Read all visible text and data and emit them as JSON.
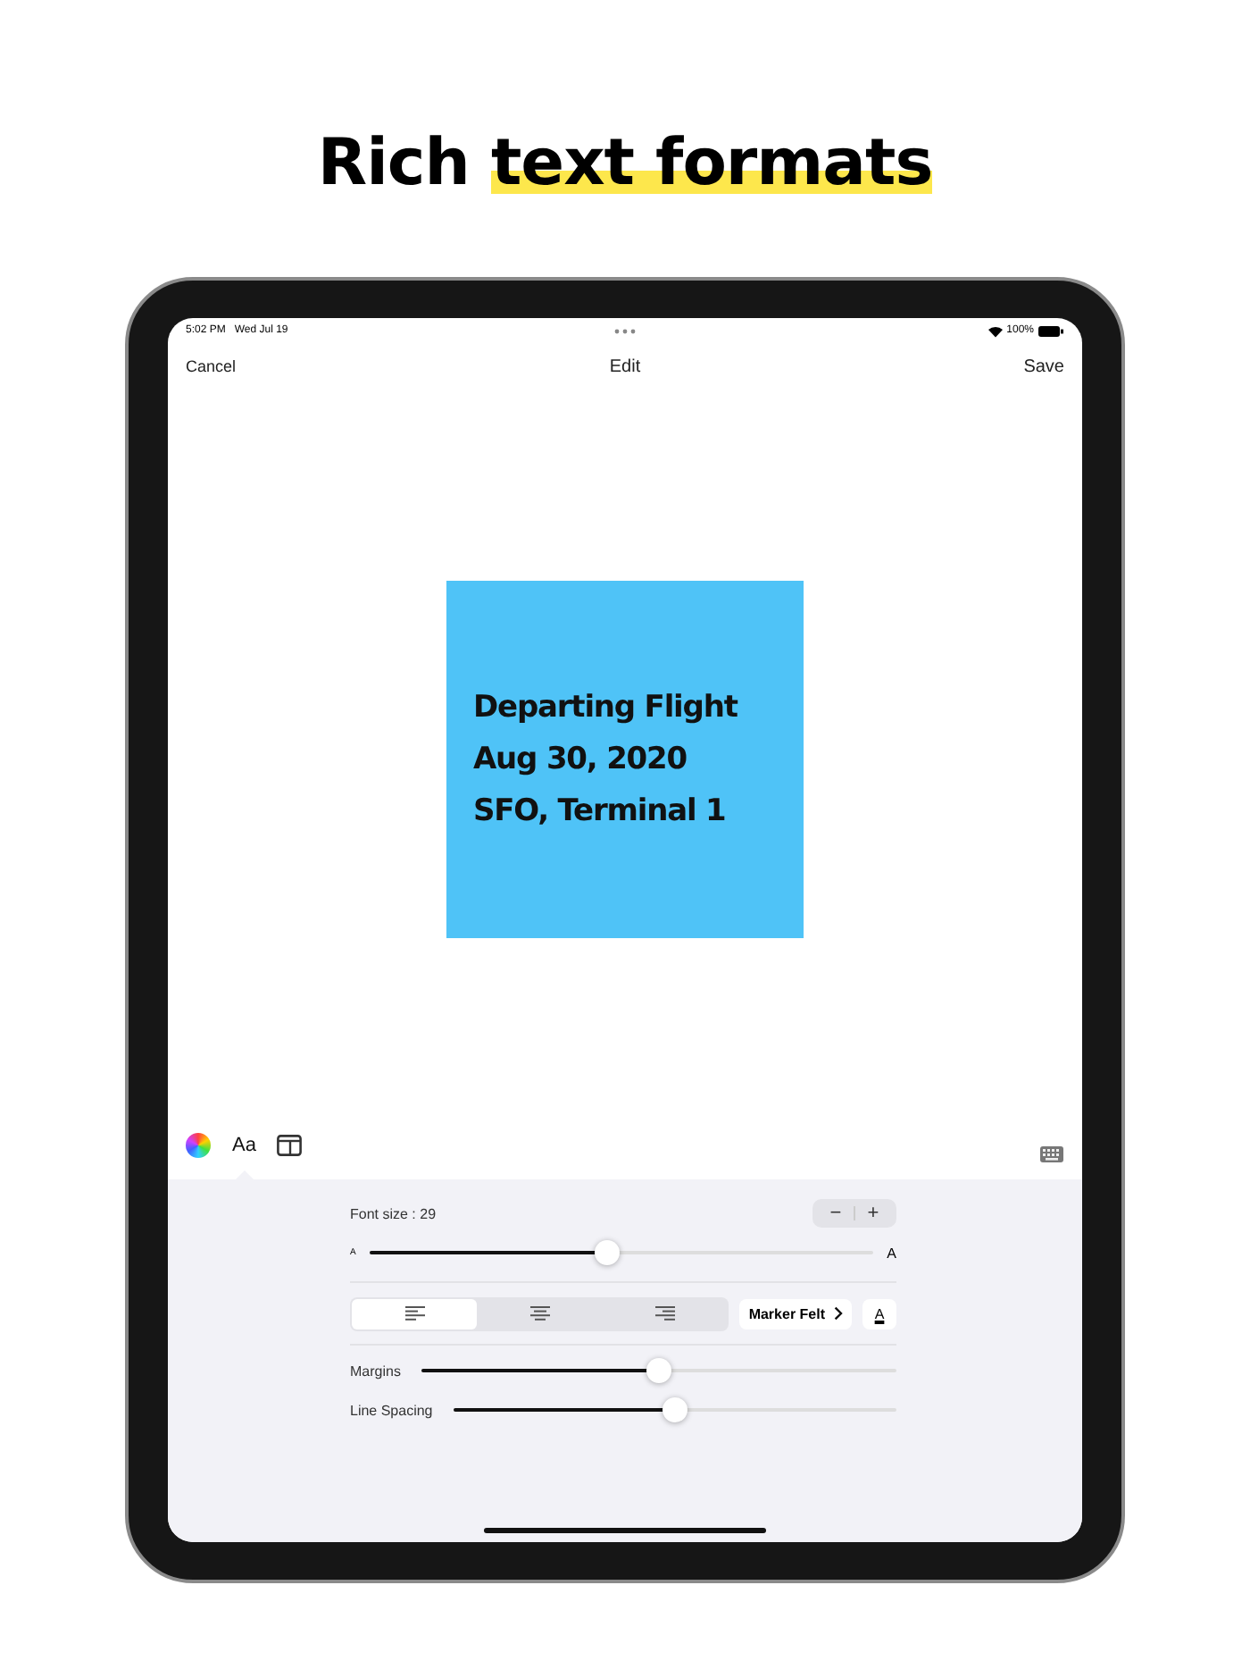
{
  "headline": {
    "plain": "Rich",
    "highlighted": "text formats"
  },
  "status_bar": {
    "time": "5:02 PM",
    "date": "Wed Jul 19",
    "battery": "100%"
  },
  "nav_bar": {
    "cancel": "Cancel",
    "title": "Edit",
    "save": "Save"
  },
  "note": {
    "color": "#4fc3f7",
    "lines": [
      "Departing Flight",
      "Aug 30, 2020",
      "SFO, Terminal 1"
    ]
  },
  "format_tabs": [
    {
      "kind": "color",
      "selected": false
    },
    {
      "kind": "text",
      "label": "Aa",
      "selected": true
    },
    {
      "kind": "layout",
      "selected": false
    }
  ],
  "panel": {
    "font_size_label": "Font size  : 29",
    "minus": "−",
    "plus": "+",
    "size_slider": {
      "min_label": "A",
      "max_label": "A",
      "level": 0.47
    },
    "alignments": [
      {
        "kind": "left",
        "selected": true
      },
      {
        "kind": "center",
        "selected": false
      },
      {
        "kind": "right",
        "selected": false
      }
    ],
    "font_button": "Marker Felt",
    "text_color_button": "A",
    "sliders": [
      {
        "label": "Margins",
        "level": 0.5
      },
      {
        "label": "Line Spacing",
        "level": 0.5
      }
    ]
  }
}
